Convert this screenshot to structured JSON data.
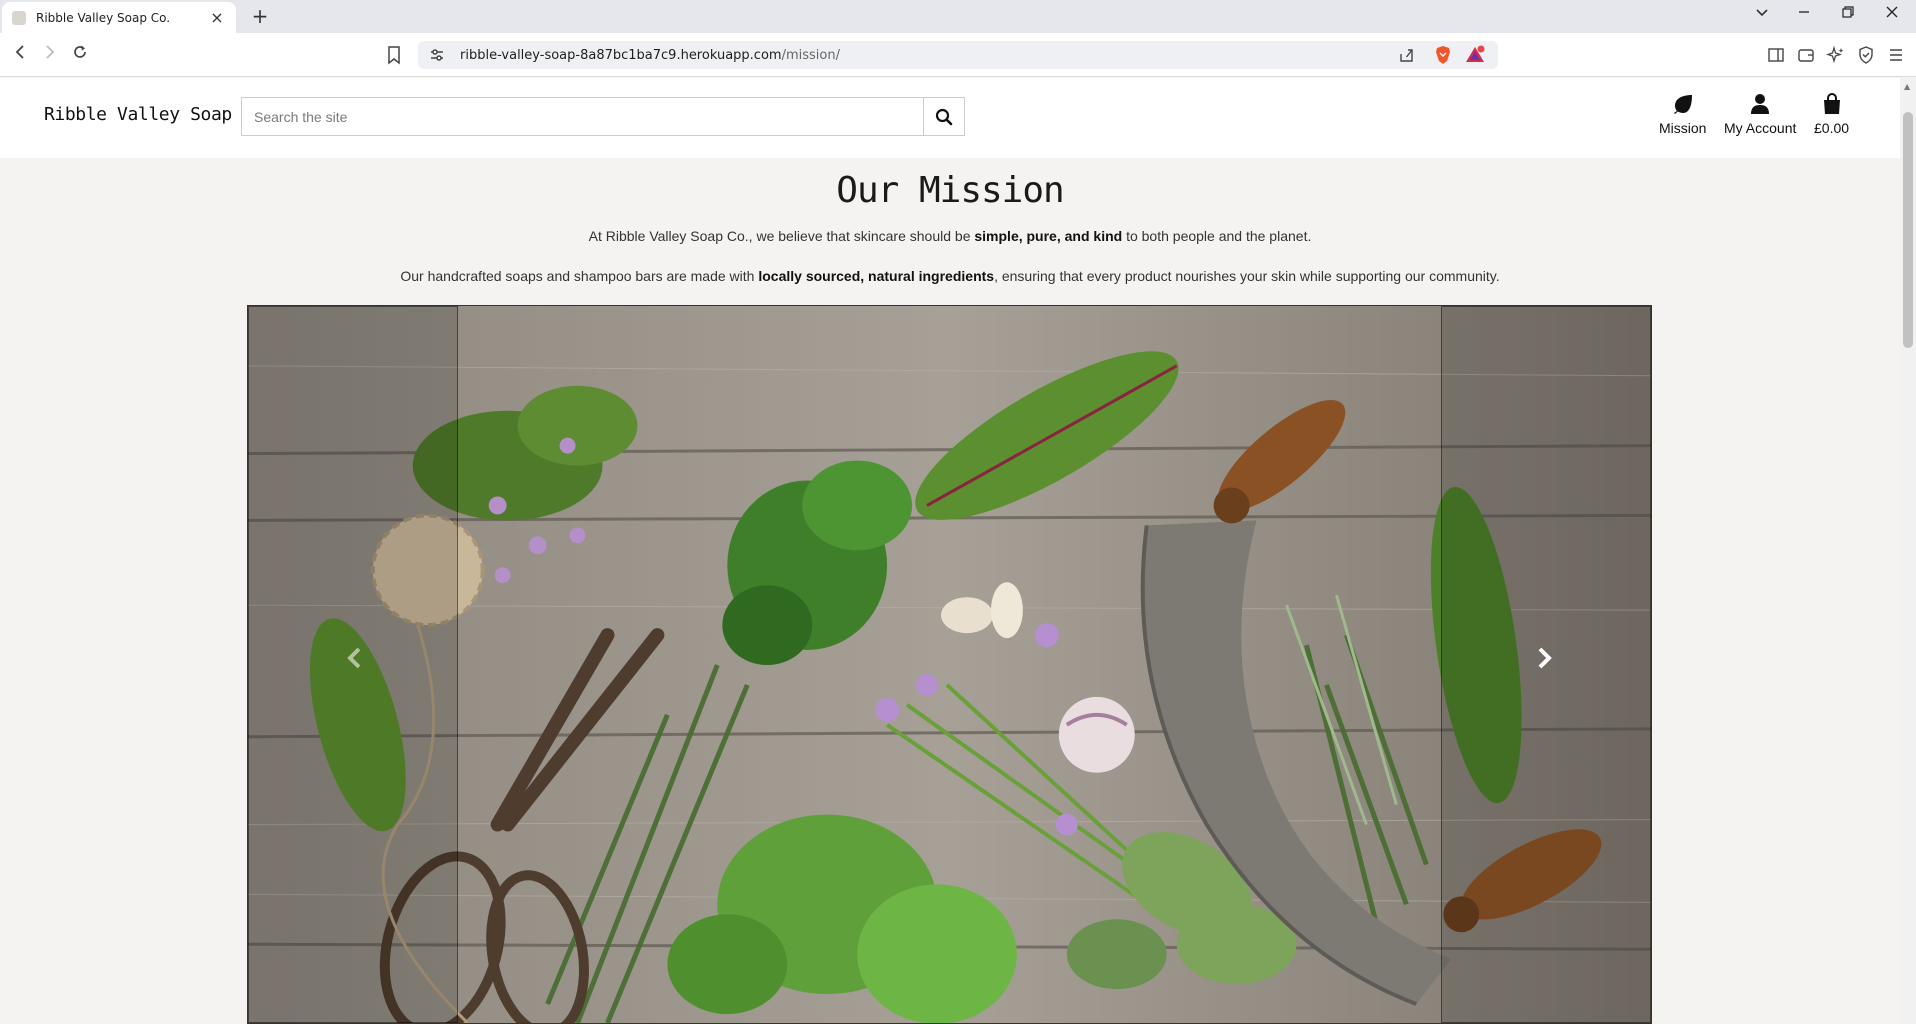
{
  "browser": {
    "tab_title": "Ribble Valley Soap Co.",
    "new_tab": "+",
    "close_tab": "×",
    "url_host": "ribble-valley-soap-8a87bc1ba7c9.herokuapp.com",
    "url_path": "/mission/",
    "win_controls": {
      "dropdown": "⌄",
      "minimize": "—",
      "restore": "❐",
      "close": "✕"
    },
    "nav": {
      "back": "‹",
      "forward": "›",
      "reload": "↻"
    }
  },
  "header": {
    "logo": "Ribble Valley Soap Co.",
    "search": {
      "placeholder": "Search the site"
    },
    "nav": [
      {
        "label": "Mission",
        "icon": "leaf-icon"
      },
      {
        "label": "My Account",
        "icon": "user-icon"
      },
      {
        "label": "£0.00",
        "icon": "shopping-bag-icon"
      }
    ]
  },
  "main": {
    "title": "Our Mission",
    "intro1": {
      "before": "At Ribble Valley Soap Co., we believe that skincare should be ",
      "bold": "simple, pure, and kind",
      "after": " to both people and the planet."
    },
    "intro2": {
      "before": "Our handcrafted soaps and shampoo bars are made with ",
      "bold": "locally sourced, natural ingredients",
      "after": ", ensuring that every product nourishes your skin while supporting our community."
    },
    "carousel": {
      "prev": "‹",
      "next": "›"
    }
  }
}
